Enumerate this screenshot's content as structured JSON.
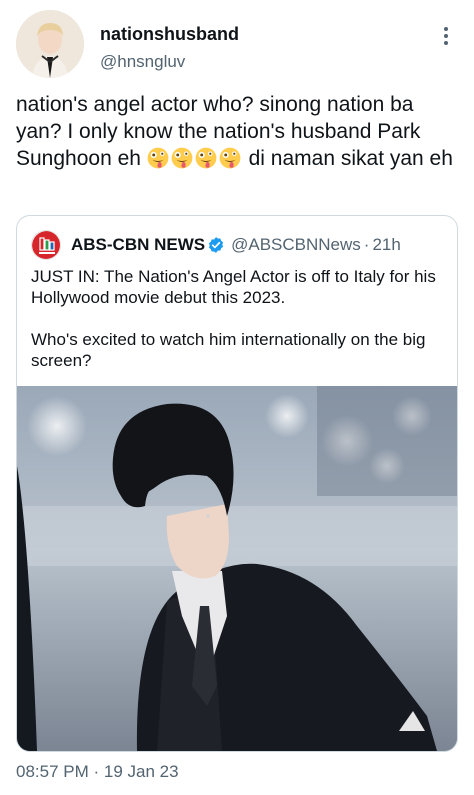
{
  "tweet": {
    "author": {
      "display_name": "nationshusband",
      "handle": "@hnsngluv"
    },
    "more_icon": "more-vertical-icon",
    "text_before_emoji": "nation's angel actor who? sinong nation ba yan? I only know the nation's husband Park Sunghoon eh ",
    "emoji": [
      "zany-face-emoji",
      "zany-face-emoji",
      "zany-face-emoji",
      "zany-face-emoji"
    ],
    "text_after_emoji": " di naman sikat yan eh",
    "timestamp": "08:57 PM · 19 Jan 23"
  },
  "quoted": {
    "author": {
      "display_name": "ABS-CBN NEWS",
      "handle": "@ABSCBNNews",
      "separator": "·",
      "time": "21h",
      "verified": true
    },
    "text_line1": "JUST IN: The Nation's Angel Actor is off to Italy for his Hollywood movie debut this 2023.",
    "text_line2": "Who's excited to watch him internationally on the big screen?",
    "photo": "photo of a young man with dark hair in a black jacket",
    "colors": {
      "verified": "#1d9bf0",
      "logo_red": "#d6262b",
      "logo_green": "#2c9b4a",
      "logo_blue": "#1e67b3"
    }
  }
}
